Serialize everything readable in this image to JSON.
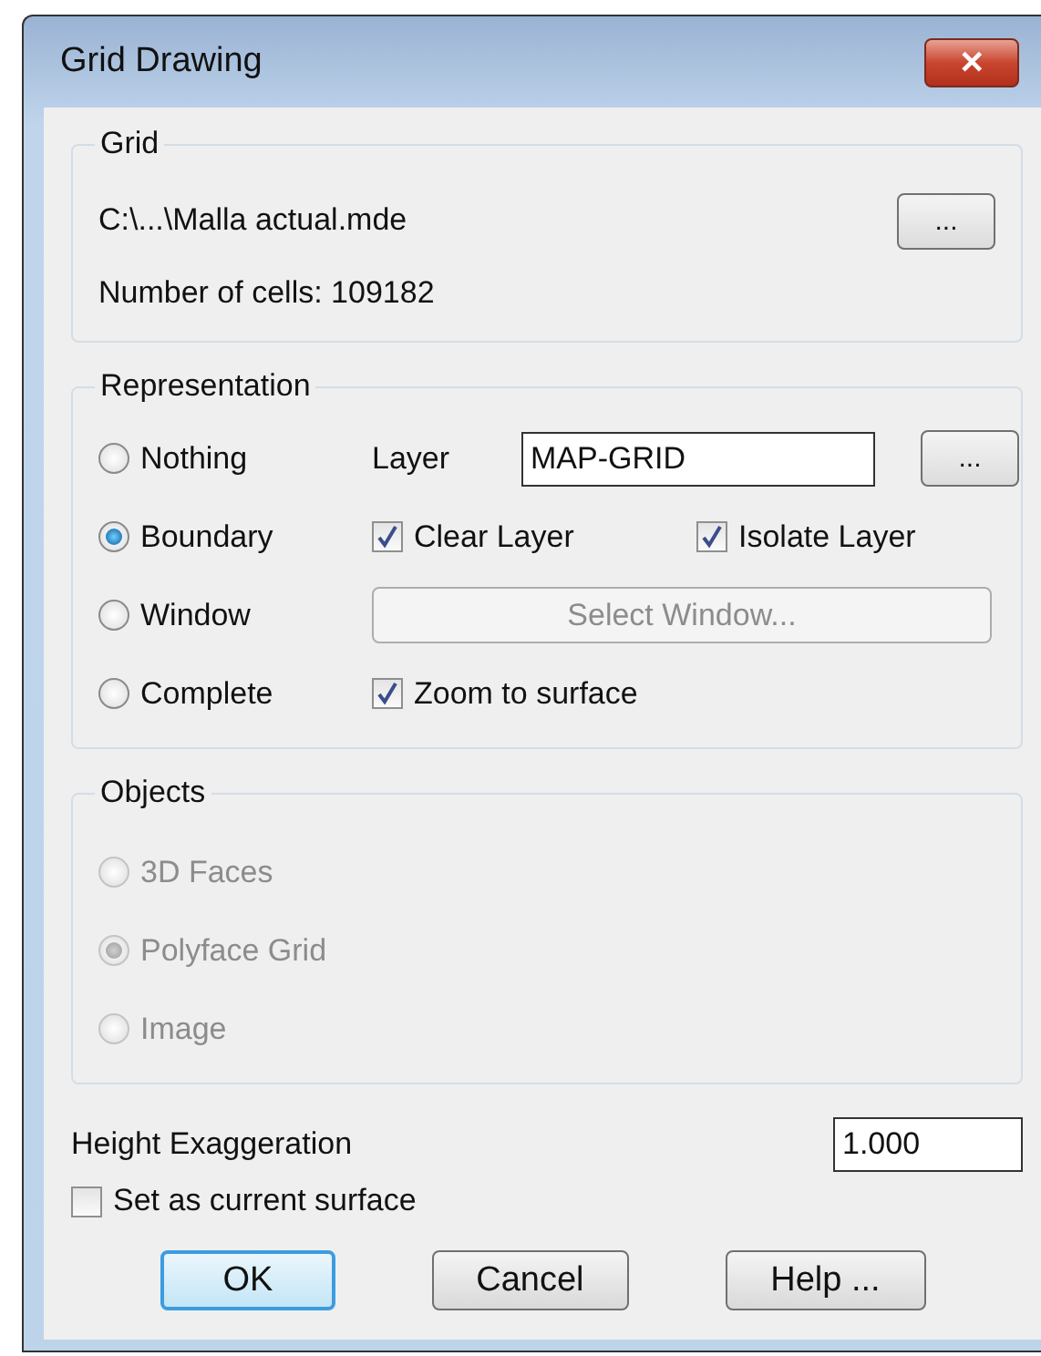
{
  "window": {
    "title": "Grid Drawing",
    "close": "✕"
  },
  "grid": {
    "legend": "Grid",
    "path": "C:\\...\\Malla actual.mde",
    "browse": "...",
    "cells": "Number of cells: 109182"
  },
  "representation": {
    "legend": "Representation",
    "options": [
      {
        "label": "Nothing",
        "selected": false
      },
      {
        "label": "Boundary",
        "selected": true
      },
      {
        "label": "Window",
        "selected": false
      },
      {
        "label": "Complete",
        "selected": false
      }
    ],
    "layer_label": "Layer",
    "layer_value": "MAP-GRID",
    "layer_browse": "...",
    "clear_layer": {
      "label": "Clear Layer",
      "checked": true
    },
    "isolate_layer": {
      "label": "Isolate Layer",
      "checked": true
    },
    "select_window": {
      "label": "Select Window...",
      "disabled": true
    },
    "zoom": {
      "label": "Zoom to surface",
      "checked": true
    }
  },
  "objects": {
    "legend": "Objects",
    "disabled": true,
    "options": [
      {
        "label": "3D Faces",
        "selected": false
      },
      {
        "label": "Polyface Grid",
        "selected": true
      },
      {
        "label": "Image",
        "selected": false
      }
    ]
  },
  "height": {
    "label": "Height Exaggeration",
    "value": "1.000"
  },
  "current_surface": {
    "label": "Set as current surface",
    "checked": false
  },
  "buttons": [
    {
      "label": "OK",
      "default": true
    },
    {
      "label": "Cancel",
      "default": false
    },
    {
      "label": "Help ...",
      "default": false
    }
  ]
}
